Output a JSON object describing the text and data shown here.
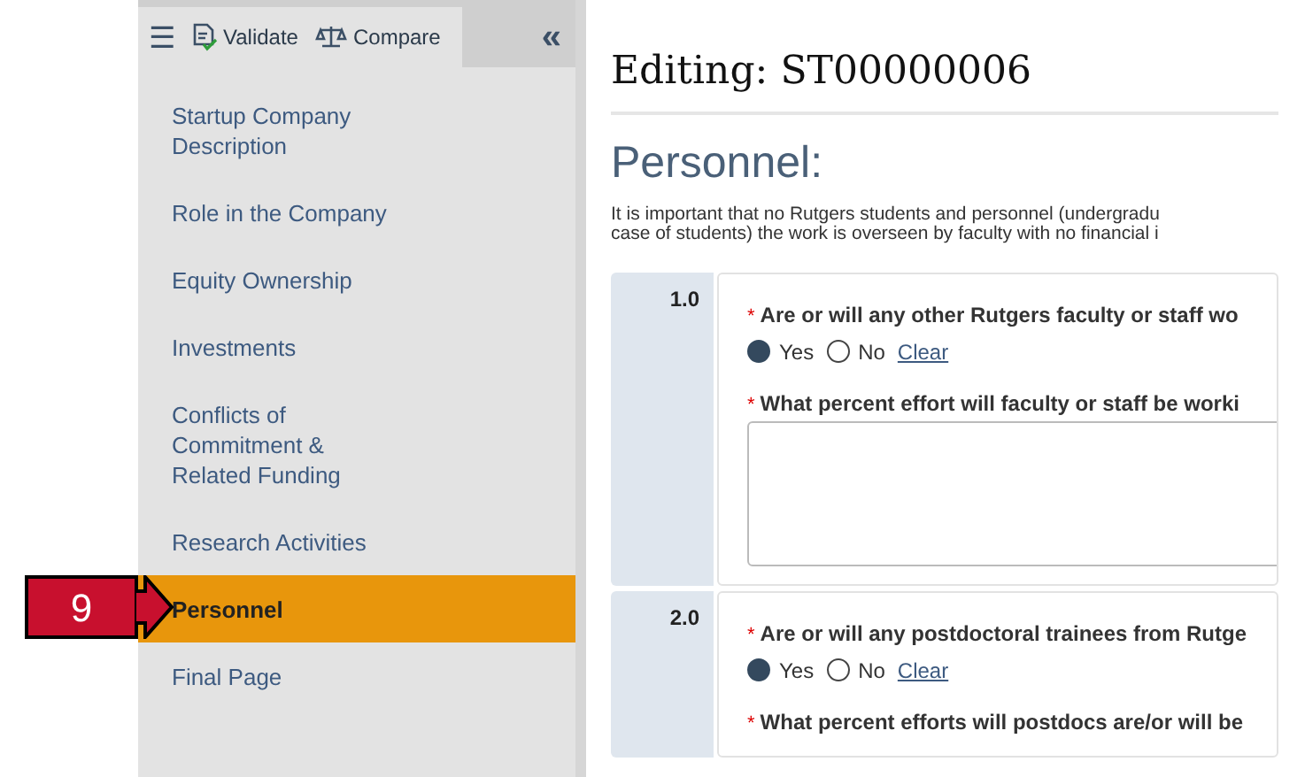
{
  "toolbar": {
    "menu_icon": "☰",
    "collapse": "«",
    "buttons": [
      {
        "kind": "validate",
        "label": "Validate"
      },
      {
        "kind": "compare",
        "label": "Compare"
      }
    ]
  },
  "sidebar": {
    "items": [
      {
        "label": "Startup Company Description",
        "selected": false
      },
      {
        "label": "Role in the Company",
        "selected": false
      },
      {
        "label": "Equity Ownership",
        "selected": false
      },
      {
        "label": "Investments",
        "selected": false
      },
      {
        "label": "Conflicts of Commitment & Related Funding",
        "selected": false
      },
      {
        "label": "Research Activities",
        "selected": false
      },
      {
        "label": "Personnel",
        "selected": true
      },
      {
        "label": "Final Page",
        "selected": false
      }
    ]
  },
  "callout": {
    "label": "9"
  },
  "page": {
    "title": "Editing: ST00000006",
    "heading": "Personnel:",
    "intro": [
      "It is important that no Rutgers students and personnel (undergradu",
      "case of students) the work is overseen by faculty with no financial i"
    ]
  },
  "questions": [
    {
      "number": "1.0",
      "required_mark": "*",
      "question": "Are or will any other Rutgers faculty or staff wo",
      "options": [
        {
          "label": "Yes",
          "selected": true
        },
        {
          "label": "No",
          "selected": false
        }
      ],
      "clear": "Clear",
      "followup": "What percent effort will faculty or staff be worki",
      "has_textarea": true
    },
    {
      "number": "2.0",
      "required_mark": "*",
      "question": "Are or will any postdoctoral trainees from Rutge",
      "options": [
        {
          "label": "Yes",
          "selected": true
        },
        {
          "label": "No",
          "selected": false
        }
      ],
      "clear": "Clear",
      "followup": "What percent efforts will postdocs are/or will be",
      "has_textarea": false
    }
  ]
}
